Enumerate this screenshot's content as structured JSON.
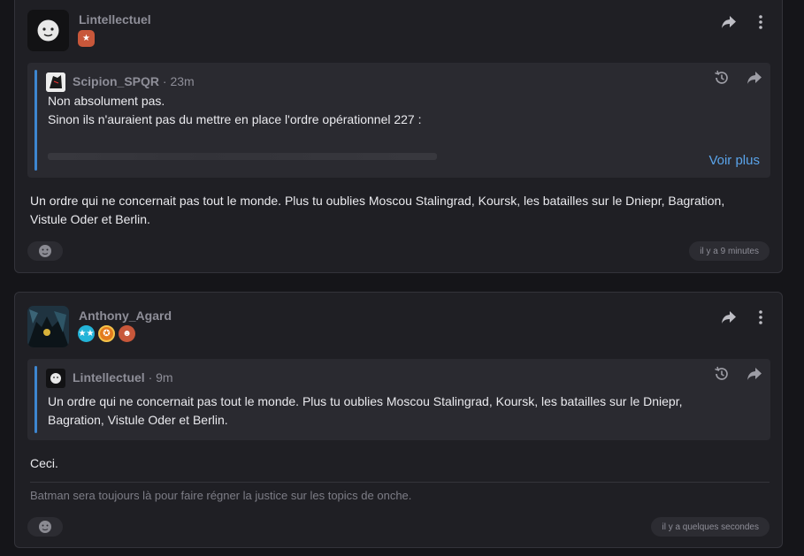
{
  "posts": [
    {
      "author": "Lintellectuel",
      "badges": [
        "star-badge"
      ],
      "quote": {
        "author": "Scipion_SPQR",
        "separator": "·",
        "time": "23m",
        "lines": [
          "Non absolument pas.",
          "Sinon ils n'auraient pas du mettre en place l'ordre opérationnel 227 :"
        ],
        "more_label": "Voir plus"
      },
      "body": "Un ordre qui ne concernait pas tout le monde. Plus tu oublies Moscou Stalingrad, Koursk, les batailles sur le Dniepr, Bagration, Vistule Oder et Berlin.",
      "timestamp": "il y a 9 minutes"
    },
    {
      "author": "Anthony_Agard",
      "badges": [
        "stars-badge",
        "medal-badge",
        "character-badge"
      ],
      "quote": {
        "author": "Lintellectuel",
        "separator": "·",
        "time": "9m",
        "lines": [
          "Un ordre qui ne concernait pas tout le monde. Plus tu oublies Moscou Stalingrad, Koursk, les batailles sur le Dniepr,",
          "Bagration, Vistule Oder et Berlin."
        ]
      },
      "body": "Ceci.",
      "signature": "Batman sera toujours là pour faire régner la justice sur les topics de onche.",
      "timestamp": "il y a quelques secondes"
    }
  ],
  "colors": {
    "background": "#151519",
    "card": "#1f1f24",
    "quote": "#2a2a30",
    "accent": "#3d86d0",
    "link": "#5aa4ea"
  },
  "icons": [
    "share-icon",
    "more-vertical-icon",
    "history-icon",
    "reaction-icon"
  ]
}
